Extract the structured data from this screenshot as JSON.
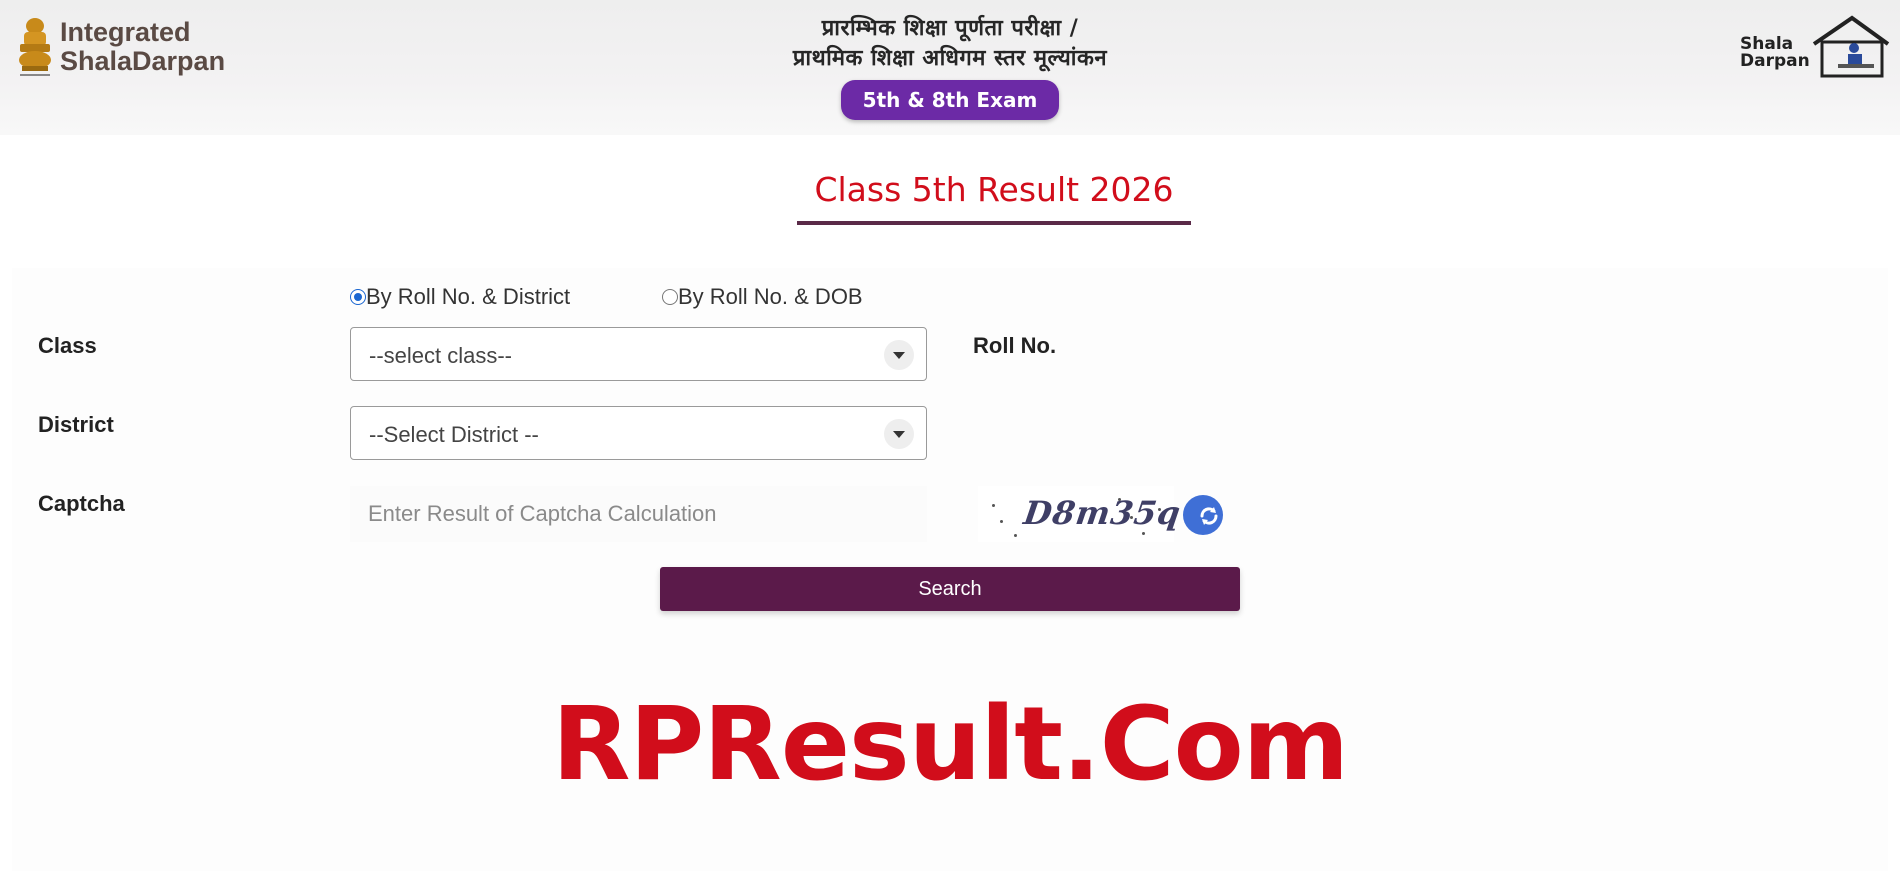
{
  "header": {
    "brand_left": {
      "line1": "Integrated",
      "line2": "ShalaDarpan"
    },
    "title_hindi_line1": "प्रारम्भिक शिक्षा पूर्णता परीक्षा /",
    "title_hindi_line2": "प्राथमिक शिक्षा अधिगम स्तर मूल्यांकन",
    "exam_pill": "5th & 8th Exam",
    "brand_right": {
      "line1": "Shala",
      "line2": "Darpan"
    }
  },
  "page_title": "Class 5th Result 2026",
  "search_mode": {
    "options": [
      {
        "label": "By Roll No. & District",
        "checked": true
      },
      {
        "label": "By Roll No. & DOB",
        "checked": false
      }
    ]
  },
  "form": {
    "class_label": "Class",
    "class_value": "--select class--",
    "roll_label": "Roll No.",
    "district_label": "District",
    "district_value": "--Select District --",
    "captcha_label": "Captcha",
    "captcha_placeholder": "Enter Result of Captcha Calculation",
    "captcha_text": "D8m35q",
    "search_button": "Search"
  },
  "watermark": "RPResult.Com",
  "colors": {
    "accent_red": "#d10d1b",
    "button_purple": "#5b1a4a",
    "pill_purple": "#6c2aa6",
    "refresh_blue": "#3f6fd6"
  },
  "icons": [
    "emblem-icon",
    "house-logo-icon",
    "chevron-down-icon",
    "refresh-icon"
  ]
}
